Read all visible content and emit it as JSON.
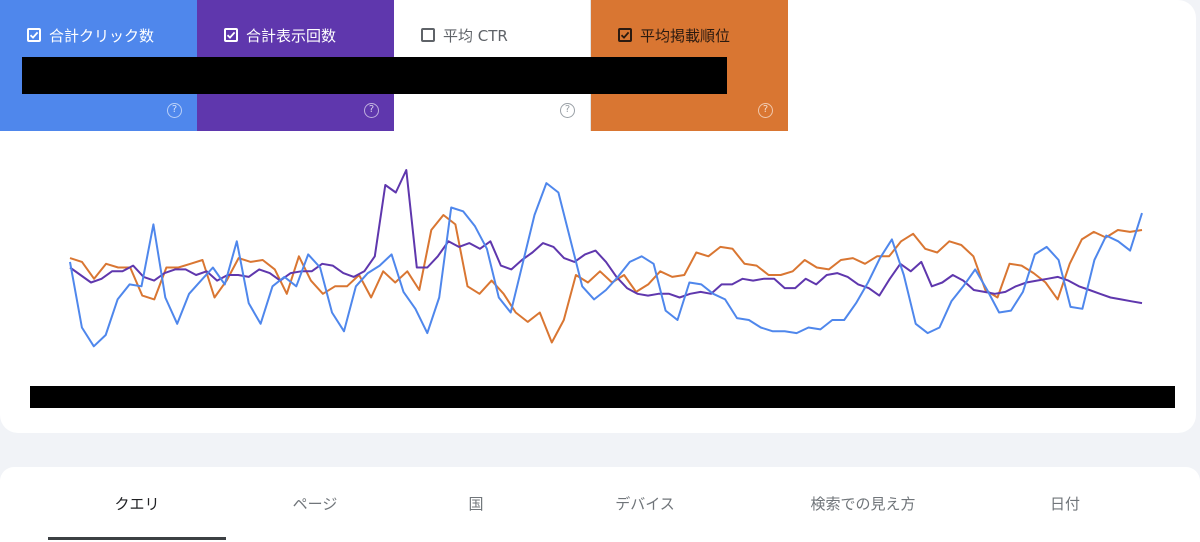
{
  "metrics": [
    {
      "label": "合計クリック数",
      "checked": true,
      "color": "#4f87ec",
      "help_icon": "help-circle-icon"
    },
    {
      "label": "合計表示回数",
      "checked": true,
      "color": "#5f37ad",
      "help_icon": "help-circle-icon"
    },
    {
      "label": "平均 CTR",
      "checked": false,
      "color": "#ffffff",
      "help_icon": "help-circle-icon"
    },
    {
      "label": "平均掲載順位",
      "checked": true,
      "color": "#d97632",
      "help_icon": "help-circle-icon"
    }
  ],
  "help_glyph": "?",
  "chart_data": {
    "type": "line",
    "y_scale": "independent per series, no axis labels shown",
    "grid": false,
    "series": [
      {
        "name": "合計クリック数",
        "color": "#4f87ec",
        "values": [
          55,
          20,
          10,
          16,
          35,
          43,
          42,
          75,
          36,
          22,
          38,
          45,
          52,
          43,
          66,
          33,
          22,
          42,
          47,
          42,
          59,
          52,
          28,
          18,
          42,
          49,
          53,
          59,
          39,
          30,
          17,
          36,
          84,
          82,
          74,
          62,
          36,
          28,
          54,
          80,
          97,
          92,
          67,
          42,
          35,
          40,
          47,
          55,
          58,
          54,
          29,
          24,
          44,
          43,
          38,
          35,
          25,
          24,
          20,
          18,
          18,
          17,
          20,
          19,
          24,
          24,
          33,
          44,
          57,
          67,
          48,
          22,
          17,
          20,
          34,
          42,
          51,
          40,
          28,
          29,
          39,
          59,
          63,
          56,
          31,
          30,
          56,
          69,
          66,
          61,
          81
        ]
      },
      {
        "name": "合計表示回数",
        "color": "#5f37ad",
        "values": [
          52,
          48,
          44,
          46,
          50,
          50,
          53,
          47,
          45,
          49,
          51,
          51,
          48,
          50,
          45,
          48,
          48,
          47,
          51,
          49,
          45,
          49,
          50,
          50,
          54,
          53,
          49,
          47,
          50,
          58,
          96,
          92,
          104,
          52,
          52,
          58,
          66,
          63,
          65,
          62,
          66,
          53,
          51,
          56,
          60,
          65,
          63,
          57,
          55,
          59,
          61,
          55,
          47,
          41,
          38,
          37,
          38,
          38,
          36,
          38,
          39,
          38,
          43,
          43,
          46,
          45,
          46,
          46,
          41,
          41,
          46,
          43,
          48,
          49,
          47,
          43,
          41,
          37,
          46,
          54,
          50,
          55,
          42,
          44,
          48,
          45,
          40,
          39,
          38,
          39,
          42,
          44,
          45,
          46,
          47,
          45,
          42,
          40,
          38,
          36,
          35,
          34,
          33
        ]
      },
      {
        "name": "平均掲載順位",
        "color": "#d97632",
        "values": [
          57,
          55,
          46,
          54,
          52,
          52,
          37,
          35,
          52,
          52,
          54,
          56,
          36,
          45,
          57,
          55,
          56,
          51,
          38,
          58,
          45,
          38,
          42,
          42,
          48,
          36,
          50,
          44,
          50,
          40,
          72,
          80,
          75,
          42,
          38,
          45,
          38,
          28,
          23,
          28,
          12,
          24,
          48,
          44,
          50,
          44,
          48,
          39,
          43,
          50,
          47,
          48,
          60,
          58,
          63,
          62,
          54,
          53,
          48,
          48,
          50,
          56,
          52,
          51,
          56,
          57,
          54,
          58,
          58,
          66,
          70,
          62,
          60,
          66,
          64,
          58,
          40,
          36,
          54,
          53,
          49,
          44,
          35,
          54,
          67,
          71,
          68,
          72,
          71,
          72
        ]
      }
    ]
  },
  "tabs": [
    {
      "label": "クエリ",
      "active": true
    },
    {
      "label": "ページ",
      "active": false
    },
    {
      "label": "国",
      "active": false
    },
    {
      "label": "デバイス",
      "active": false
    },
    {
      "label": "検索での見え方",
      "active": false
    },
    {
      "label": "日付",
      "active": false
    }
  ]
}
